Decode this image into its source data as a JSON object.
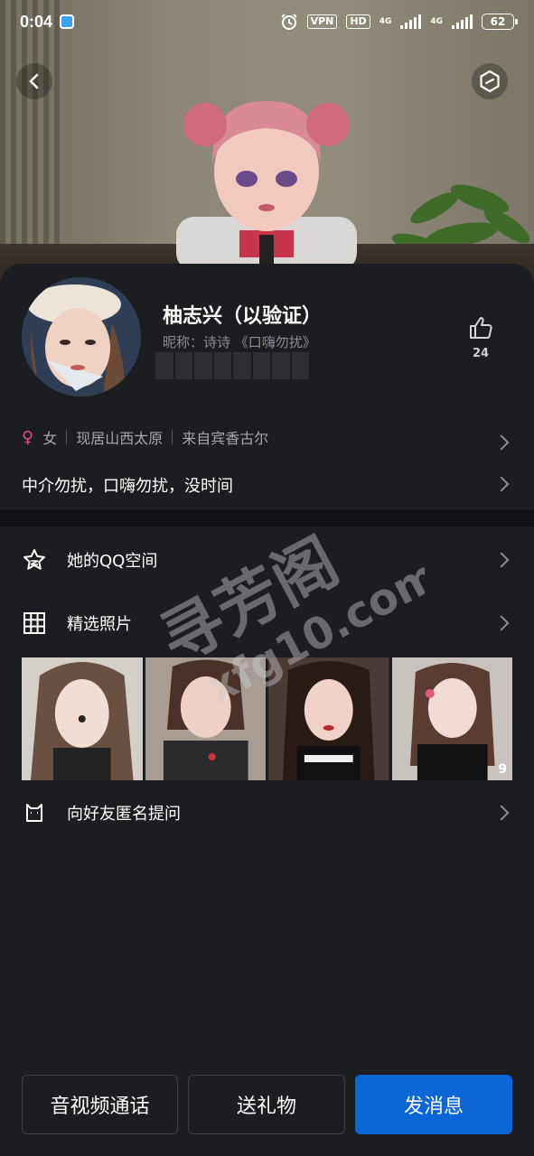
{
  "status_bar": {
    "time": "0:04",
    "vpn": "VPN",
    "hd": "HD",
    "network_1": "4G",
    "network_2": "4G",
    "battery": "62"
  },
  "profile": {
    "name": "柚志兴（以验证）",
    "nickname": "昵称：诗诗 《口嗨勿扰》",
    "likes": "24",
    "gender": "女",
    "residence": "现居山西太原",
    "origin": "来自宾香古尔",
    "signature": "中介勿扰，口嗨勿扰，没时间"
  },
  "menu": {
    "qzone": "她的QQ空间",
    "photos": "精选照片",
    "anonymous": "向好友匿名提问"
  },
  "photo_count": "9",
  "watermark": {
    "line1": "寻芳阁",
    "line2": "xfg10.com"
  },
  "actions": {
    "call": "音视频通话",
    "gift": "送礼物",
    "message": "发消息"
  },
  "colors": {
    "background": "#1c1d21",
    "primary": "#0d66d6",
    "female": "#e0508a"
  }
}
